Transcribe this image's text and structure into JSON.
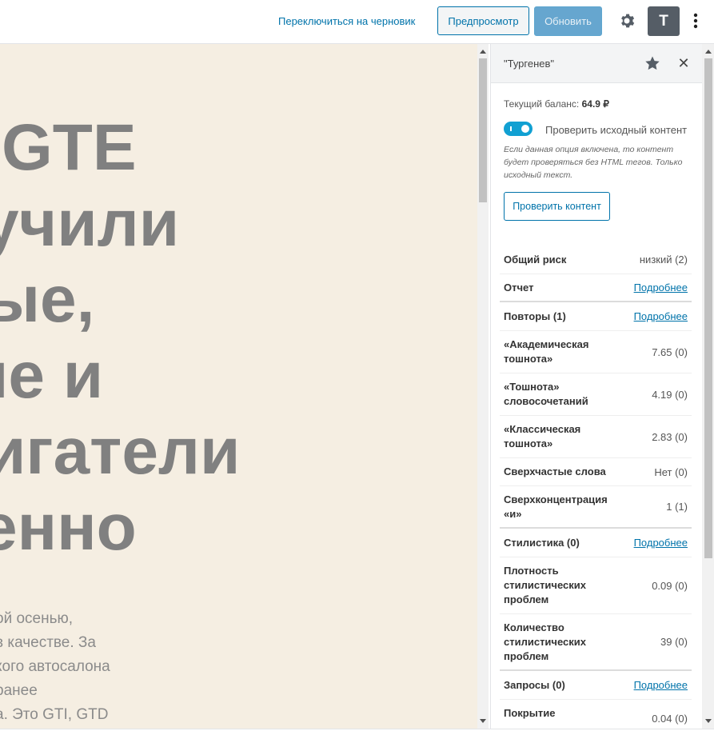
{
  "toolbar": {
    "switch_draft": "Переключиться на черновик",
    "preview": "Предпросмотр",
    "update": "Обновить",
    "t_button": "T",
    "settings_icon": "gear-icon",
    "more_icon": "kebab-icon"
  },
  "editor": {
    "headline": [
      "GTE",
      "учили",
      "ые,",
      "ие и",
      "игатели",
      "енно"
    ],
    "paragraph": [
      "ой осенью,",
      " в качестве. За",
      "кого автосалона",
      "ранее",
      "а. Это GTI, GTD"
    ]
  },
  "sidebar": {
    "title": "\"Тургенев\"",
    "balance_label": "Текущий баланс:",
    "balance_value": "64.9 ₽",
    "toggle_label": "Проверить исходный контент",
    "hint": "Если данная опция включена, то контент будет проверяться без HTML тегов. Только исходный текст.",
    "check_button": "Проверить контент",
    "rows": [
      {
        "label": "Общий риск",
        "value": "низкий (2)"
      },
      {
        "label": "Отчет",
        "link": "Подробнее"
      },
      {
        "label": "Повторы (1)",
        "link": "Подробнее"
      },
      {
        "label": "«Академическая тошнота»",
        "value": "7.65 (0)"
      },
      {
        "label": "«Тошнота» словосочетаний",
        "value": "4.19 (0)"
      },
      {
        "label": "«Классическая тошнота»",
        "value": "2.83 (0)"
      },
      {
        "label": "Сверхчастые слова",
        "value": "Нет (0)"
      },
      {
        "label": "Сверхконцентрация «и»",
        "value": "1 (1)"
      },
      {
        "label": "Стилистика (0)",
        "link": "Подробнее"
      },
      {
        "label": "Плотность стилистических проблем",
        "value": "0.09 (0)"
      },
      {
        "label": "Количество стилистических проблем",
        "value": "39 (0)"
      },
      {
        "label": "Запросы (0)",
        "link": "Подробнее"
      },
      {
        "label": "Покрытие",
        "value": "0.04 (0)"
      }
    ]
  },
  "colors": {
    "accent": "#0073aa",
    "canvas_bg": "#f5eee2",
    "toggle_on": "#11a0d2"
  }
}
